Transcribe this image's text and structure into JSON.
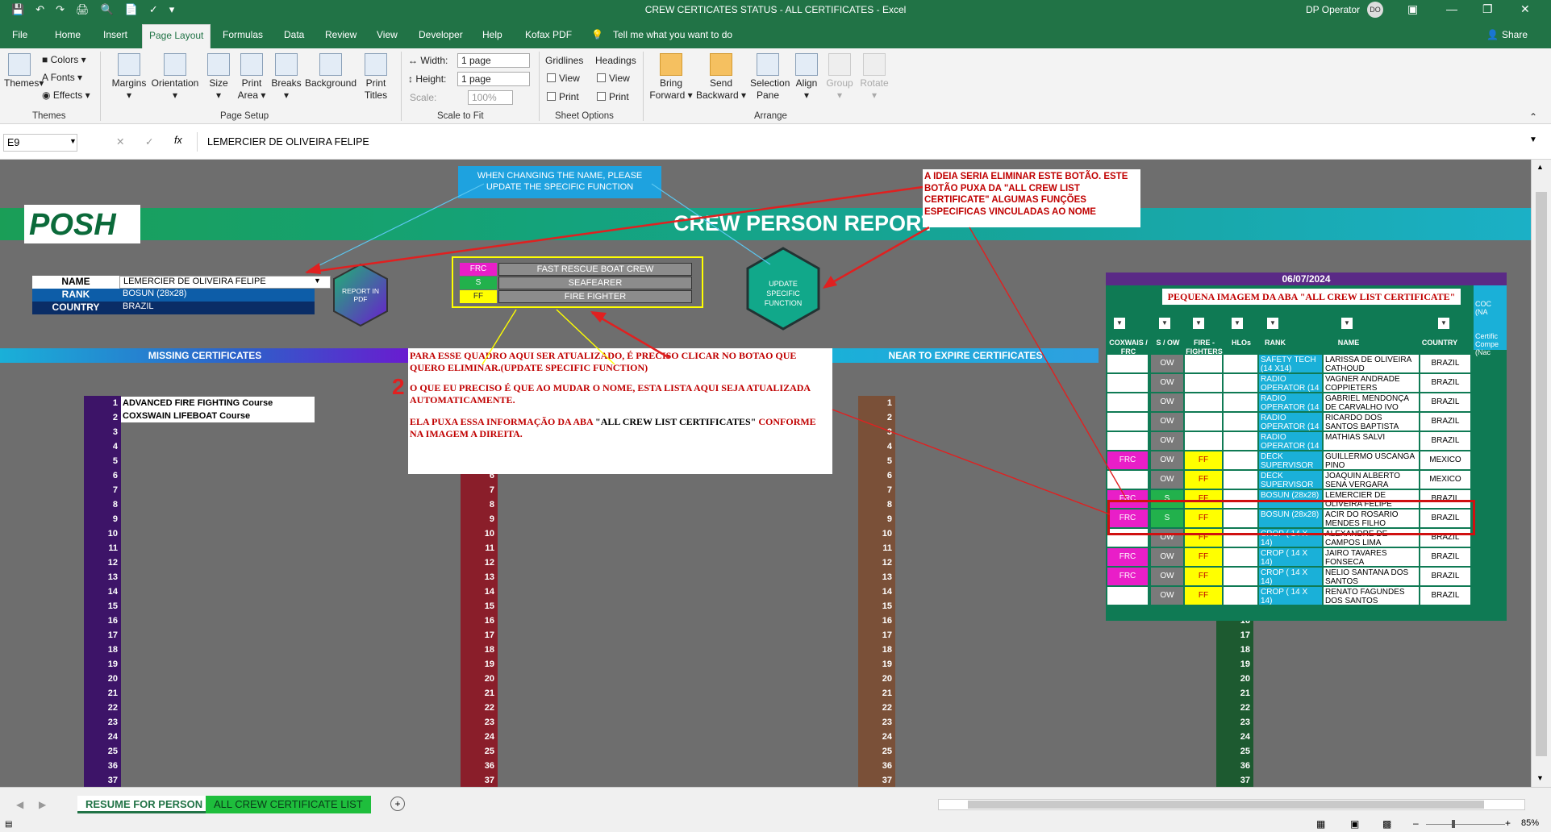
{
  "titlebar": {
    "title": "CREW CERTICATES STATUS - ALL CERTIFICATES  -  Excel",
    "user": "DP Operator",
    "initials": "DO"
  },
  "menu": {
    "tabs": [
      "File",
      "Home",
      "Insert",
      "Page Layout",
      "Formulas",
      "Data",
      "Review",
      "View",
      "Developer",
      "Help",
      "Kofax PDF"
    ],
    "tell_me": "Tell me what you want to do",
    "share": "Share",
    "active": "Page Layout"
  },
  "ribbon": {
    "themes": "Themes",
    "colors": "Colors",
    "fonts": "Fonts",
    "effects": "Effects",
    "themes_group": "Themes",
    "margins": "Margins",
    "orientation": "Orientation",
    "size": "Size",
    "print_area": "Print Area",
    "breaks": "Breaks",
    "background": "Background",
    "print_titles": "Print Titles",
    "page_setup_group": "Page Setup",
    "width_label": "Width:",
    "width_value": "1 page",
    "height_label": "Height:",
    "height_value": "1 page",
    "scale_label": "Scale:",
    "scale_value": "100%",
    "scale_group": "Scale to Fit",
    "gridlines": "Gridlines",
    "headings": "Headings",
    "view": "View",
    "print": "Print",
    "sheet_options_group": "Sheet Options",
    "bring_forward": "Bring Forward",
    "send_backward": "Send Backward",
    "selection_pane": "Selection Pane",
    "align": "Align",
    "group": "Group",
    "rotate": "Rotate",
    "arrange_group": "Arrange"
  },
  "formula_bar": {
    "name_box": "E9",
    "fx": "fx",
    "formula": "LEMERCIER DE OLIVEIRA FELIPE"
  },
  "sheet": {
    "note_top": "WHEN CHANGING THE NAME, PLEASE UPDATE THE SPECIFIC FUNCTION",
    "logo": "POSH",
    "banner_title": "CREW PERSON REPORT",
    "name_label": "NAME",
    "name_value": "LEMERCIER DE OLIVEIRA FELIPE",
    "rank_label": "RANK",
    "rank_value": "BOSUN (28x28)",
    "country_label": "COUNTRY",
    "country_value": "BRAZIL",
    "report_pdf_button": "REPORT IN PDF",
    "update_button": "UPDATE SPECIFIC FUNCTION",
    "functions": [
      {
        "code": "FRC",
        "desc": "FAST RESCUE BOAT CREW",
        "color": "#e91ec8"
      },
      {
        "code": "S",
        "desc": "SEAFEARER",
        "color": "#22b14c"
      },
      {
        "code": "FF",
        "desc": "FIRE FIGHTER",
        "color": "#ffff00"
      }
    ],
    "missing_header": "MISSING CERTIFICATES",
    "near_expire_header": "NEAR TO EXPIRE CERTIFICATES",
    "missing_items": [
      "ADVANCED FIRE FIGHTING Course",
      "COXSWAIN LIFEBOAT Course"
    ],
    "row_numbers": [
      "1",
      "2",
      "3",
      "4",
      "5",
      "6",
      "7",
      "8",
      "9",
      "10",
      "11",
      "12",
      "13",
      "14",
      "15",
      "16",
      "17",
      "18",
      "19",
      "20",
      "21",
      "22",
      "23",
      "24",
      "25",
      "36",
      "37"
    ],
    "annotation_1_number": "1",
    "annotation_1_text": "A IDEIA SERIA ELIMINAR ESTE BOTÃO. ESTE BOTÃO PUXA DA \"ALL CREW LIST CERTIFICATE\" ALGUMAS FUNÇÕES ESPECIFICAS VINCULADAS AO NOME",
    "annotation_2_number": "2",
    "annotation_2_p1": "PARA ESSE QUADRO AQUI SER ATUALIZADO, É PRECISO CLICAR NO BOTAO QUE QUERO ELIMINAR.(UPDATE SPECIFIC FUNCTION)",
    "annotation_2_p2": "O QUE EU PRECISO É QUE AO MUDAR O NOME, ESTA LISTA AQUI SEJA ATUALIZADA AUTOMATICAMENTE.",
    "annotation_2_p3_a": "ELA PUXA ESSA INFORMAÇÃO DA ABA ",
    "annotation_2_p3_b": "\"ALL CREW LIST CERTIFICATES\"",
    "annotation_2_p3_c": " CONFORME NA IMAGEM A DIREITA.",
    "side_image": {
      "date": "06/07/2024",
      "caption": "PEQUENA IMAGEM DA ABA \"ALL CREW LIST CERTIFICATE\"",
      "coc": "COC (NA",
      "cert_comp": "Certific Compe (Nac",
      "headers": [
        "COXWAIS / FRC",
        "S / OW",
        "FIRE - FIGHTERS",
        "HLOs",
        "RANK",
        "NAME",
        "COUNTRY"
      ],
      "rows": [
        {
          "frc": "",
          "sow": "OW",
          "ff": "",
          "rank": "SAFETY TECH (14 X14)",
          "name": "LARISSA DE OLIVEIRA CATHOUD",
          "country": "BRAZIL"
        },
        {
          "frc": "",
          "sow": "OW",
          "ff": "",
          "rank": "RADIO OPERATOR (14",
          "name": "VAGNER ANDRADE COPPIETERS",
          "country": "BRAZIL"
        },
        {
          "frc": "",
          "sow": "OW",
          "ff": "",
          "rank": "RADIO OPERATOR (14",
          "name": "GABRIEL MENDONÇA DE CARVALHO IVO",
          "country": "BRAZIL"
        },
        {
          "frc": "",
          "sow": "OW",
          "ff": "",
          "rank": "RADIO OPERATOR (14",
          "name": "RICARDO DOS SANTOS BAPTISTA",
          "country": "BRAZIL"
        },
        {
          "frc": "",
          "sow": "OW",
          "ff": "",
          "rank": "RADIO OPERATOR (14",
          "name": "MATHIAS SALVI",
          "country": "BRAZIL"
        },
        {
          "frc": "FRC",
          "sow": "OW",
          "ff": "FF",
          "rank": "DECK SUPERVISOR",
          "name": "GUILLERMO USCANGA PINO",
          "country": "MEXICO"
        },
        {
          "frc": "",
          "sow": "OW",
          "ff": "FF",
          "rank": "DECK SUPERVISOR",
          "name": "JOAQUIN ALBERTO SENA VERGARA",
          "country": "MEXICO"
        },
        {
          "frc": "FRC",
          "sow": "S",
          "ff": "FF",
          "rank": "BOSUN (28x28)",
          "name": "LEMERCIER DE OLIVEIRA FELIPE",
          "country": "BRAZIL"
        },
        {
          "frc": "FRC",
          "sow": "S",
          "ff": "FF",
          "rank": "BOSUN (28x28)",
          "name": "ACIR DO ROSARIO MENDES FILHO",
          "country": "BRAZIL"
        },
        {
          "frc": "",
          "sow": "OW",
          "ff": "FF",
          "rank": "CROP ( 14 X 14)",
          "name": "ALEXANDRE DE CAMPOS LIMA BORGES",
          "country": "BRAZIL"
        },
        {
          "frc": "FRC",
          "sow": "OW",
          "ff": "FF",
          "rank": "CROP ( 14 X 14)",
          "name": "JAIRO TAVARES FONSECA",
          "country": "BRAZIL"
        },
        {
          "frc": "FRC",
          "sow": "OW",
          "ff": "FF",
          "rank": "CROP ( 14 X 14)",
          "name": "NELIO SANTANA DOS SANTOS",
          "country": "BRAZIL"
        },
        {
          "frc": "",
          "sow": "OW",
          "ff": "FF",
          "rank": "CROP ( 14 X 14)",
          "name": "RENATO FAGUNDES DOS SANTOS",
          "country": "BRAZIL"
        }
      ]
    }
  },
  "status": {
    "tabs": [
      "RESUME FOR PERSON",
      "ALL CREW CERTIFICATE LIST"
    ],
    "zoom": "85%"
  }
}
